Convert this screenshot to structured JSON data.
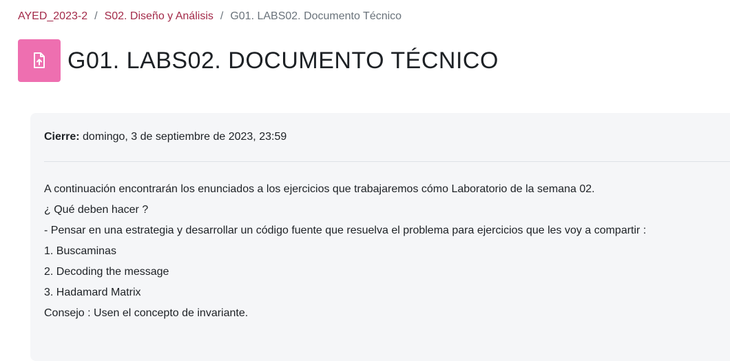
{
  "breadcrumb": {
    "items": [
      "AYED_2023-2",
      "S02. Diseño y Análisis"
    ],
    "separator": "/",
    "current": "G01. LABS02. Documento Técnico"
  },
  "header": {
    "icon": "file-upload-icon",
    "icon_color": "#ee6fb0",
    "title": "G01. LABS02. DOCUMENTO TÉCNICO"
  },
  "dates": {
    "label": "Cierre:",
    "value": " domingo, 3 de septiembre de 2023, 23:59"
  },
  "description": {
    "lines": [
      "A continuación encontrarán los enunciados a los ejercicios que trabajaremos cómo Laboratorio de la semana 02.",
      "¿ Qué deben hacer ?",
      "- Pensar en una estrategia y desarrollar un código fuente que resuelva el problema para ejercicios que les voy a compartir :",
      "1. Buscaminas",
      "2. Decoding the message",
      "3. Hadamard Matrix",
      "Consejo : Usen el concepto de invariante."
    ]
  },
  "colors": {
    "link": "#a32a49",
    "muted": "#6a737b",
    "card_background": "#f5f6f8"
  }
}
